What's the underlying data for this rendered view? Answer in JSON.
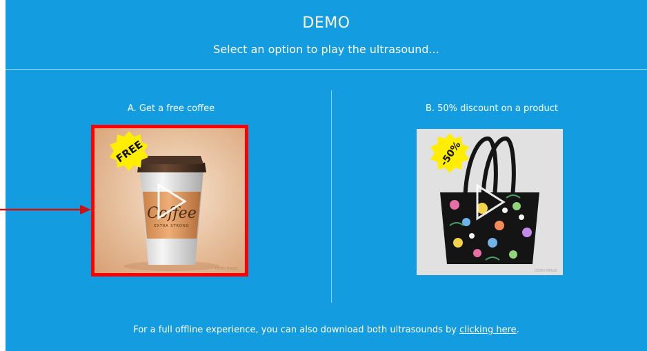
{
  "header": {
    "title": "DEMO",
    "subtitle": "Select an option to play the ultrasound..."
  },
  "options": [
    {
      "label": "A. Get a free coffee",
      "badge": "FREE",
      "image": {
        "cup_text": "Coffee",
        "cup_subtext": "EXTRA STRONG",
        "watermark": "DEMO IMAGE"
      },
      "selected": true
    },
    {
      "label": "B. 50% discount on a product",
      "badge": "-50%",
      "image": {
        "watermark": "DEMO IMAGE"
      },
      "selected": false
    }
  ],
  "footer": {
    "text": "For a full offline experience, you can also download both ultrasounds by ",
    "link_text": "clicking here",
    "end": "."
  },
  "colors": {
    "background": "#139de0",
    "badge": "#ffee00",
    "selection_border": "#ff0000",
    "annotation_arrow": "#cc1111"
  },
  "icons": [
    "play-icon",
    "starburst-badge-icon",
    "annotation-arrow-icon"
  ]
}
